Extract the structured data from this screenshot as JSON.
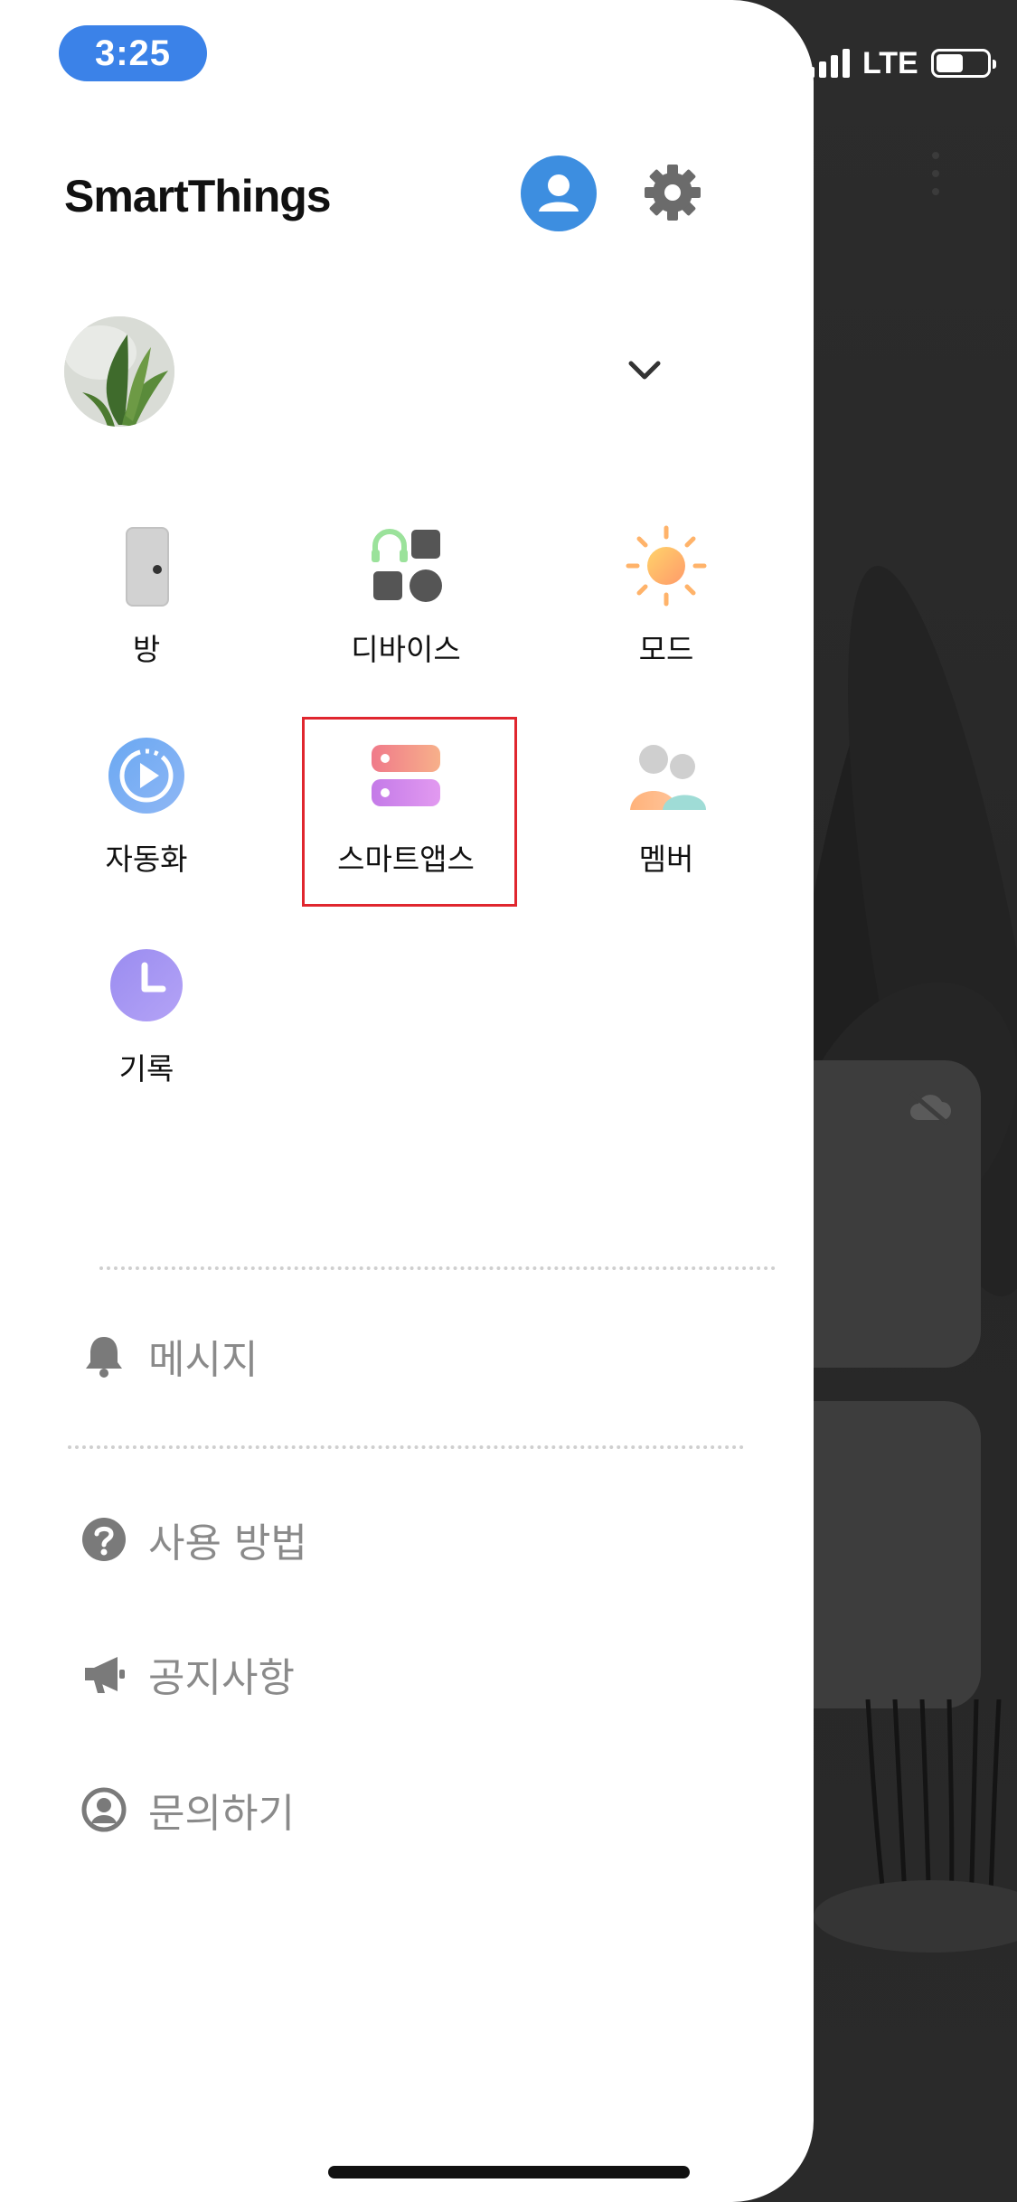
{
  "status_bar": {
    "time": "3:25",
    "network": "LTE",
    "battery_level": 0.55
  },
  "header": {
    "app_title": "SmartThings",
    "profile_icon": "person-icon",
    "settings_icon": "gear-icon"
  },
  "location": {
    "avatar_icon": "plant-photo",
    "dropdown_icon": "chevron-down-icon"
  },
  "shortcuts": [
    {
      "label": "방",
      "icon": "door-icon"
    },
    {
      "label": "디바이스",
      "icon": "devices-icon"
    },
    {
      "label": "모드",
      "icon": "sun-icon"
    },
    {
      "label": "자동화",
      "icon": "automation-play-icon"
    },
    {
      "label": "스마트앱스",
      "icon": "smartapps-icon"
    },
    {
      "label": "멤버",
      "icon": "members-icon"
    },
    {
      "label": "기록",
      "icon": "clock-icon"
    }
  ],
  "menu": {
    "messages": {
      "label": "메시지",
      "icon": "bell-icon"
    },
    "how_to_use": {
      "label": "사용 방법",
      "icon": "question-icon"
    },
    "notices": {
      "label": "공지사항",
      "icon": "megaphone-icon"
    },
    "contact": {
      "label": "문의하기",
      "icon": "contact-icon"
    }
  },
  "colors": {
    "time_pill": "#3b82e8",
    "profile": "#3d8ee0",
    "highlight": "#e0262e",
    "menu_text": "#8a8a8a"
  }
}
